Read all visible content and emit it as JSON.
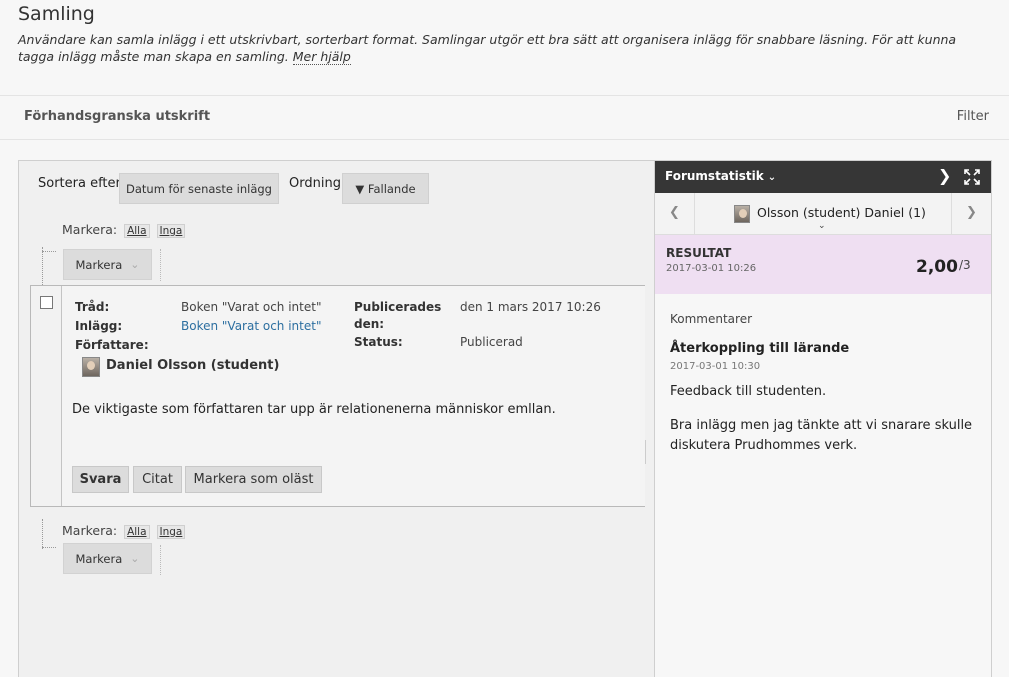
{
  "header": {
    "title": "Samling",
    "description": "Användare kan samla inlägg i ett utskrivbart, sorterbart format. Samlingar utgör ett bra sätt att organisera inlägg för snabbare läsning. För att kunna tagga inlägg måste man skapa en samling.",
    "help_link": "Mer hjälp"
  },
  "toolbar": {
    "preview_label": "Förhandsgranska utskrift",
    "filter_label": "Filter"
  },
  "sort": {
    "label": "Sortera efter",
    "value": "Datum för senaste inlägg",
    "order_label": "Ordning",
    "order_value": "▼ Fallande"
  },
  "selection": {
    "label": "Markera:",
    "all": "Alla",
    "none": "Inga",
    "mark_button": "Markera"
  },
  "post": {
    "thread_label": "Tråd:",
    "thread_value": "Boken \"Varat och intet\"",
    "post_label": "Inlägg:",
    "post_value": "Boken \"Varat och intet\"",
    "author_label": "Författare:",
    "author_name": "Daniel Olsson (student)",
    "published_label_1": "Publicerades",
    "published_label_2": "den:",
    "published_value": "den 1 mars 2017 10:26",
    "status_label": "Status:",
    "status_value": "Publicerad",
    "body": "De viktigaste som författaren tar upp är relationenerna människor emllan.",
    "actions": {
      "reply": "Svara",
      "quote": "Citat",
      "mark_unread": "Markera som oläst"
    }
  },
  "panel": {
    "title": "Forumstatistik",
    "user": "Olsson (student) Daniel (1)",
    "result": {
      "title": "RESULTAT",
      "date": "2017-03-01 10:26",
      "score": "2,00",
      "max": "/3"
    },
    "comments_label": "Kommentarer",
    "feedback": {
      "title": "Återkoppling till lärande",
      "date": "2017-03-01 10:30",
      "text_1": "Feedback till studenten.",
      "text_2": "Bra inlägg men jag tänkte att vi snarare skulle diskutera Prudhommes verk."
    }
  },
  "colors": {
    "link": "#2d6fa0",
    "panel_header": "#363636",
    "result_bg": "#efdff2"
  }
}
